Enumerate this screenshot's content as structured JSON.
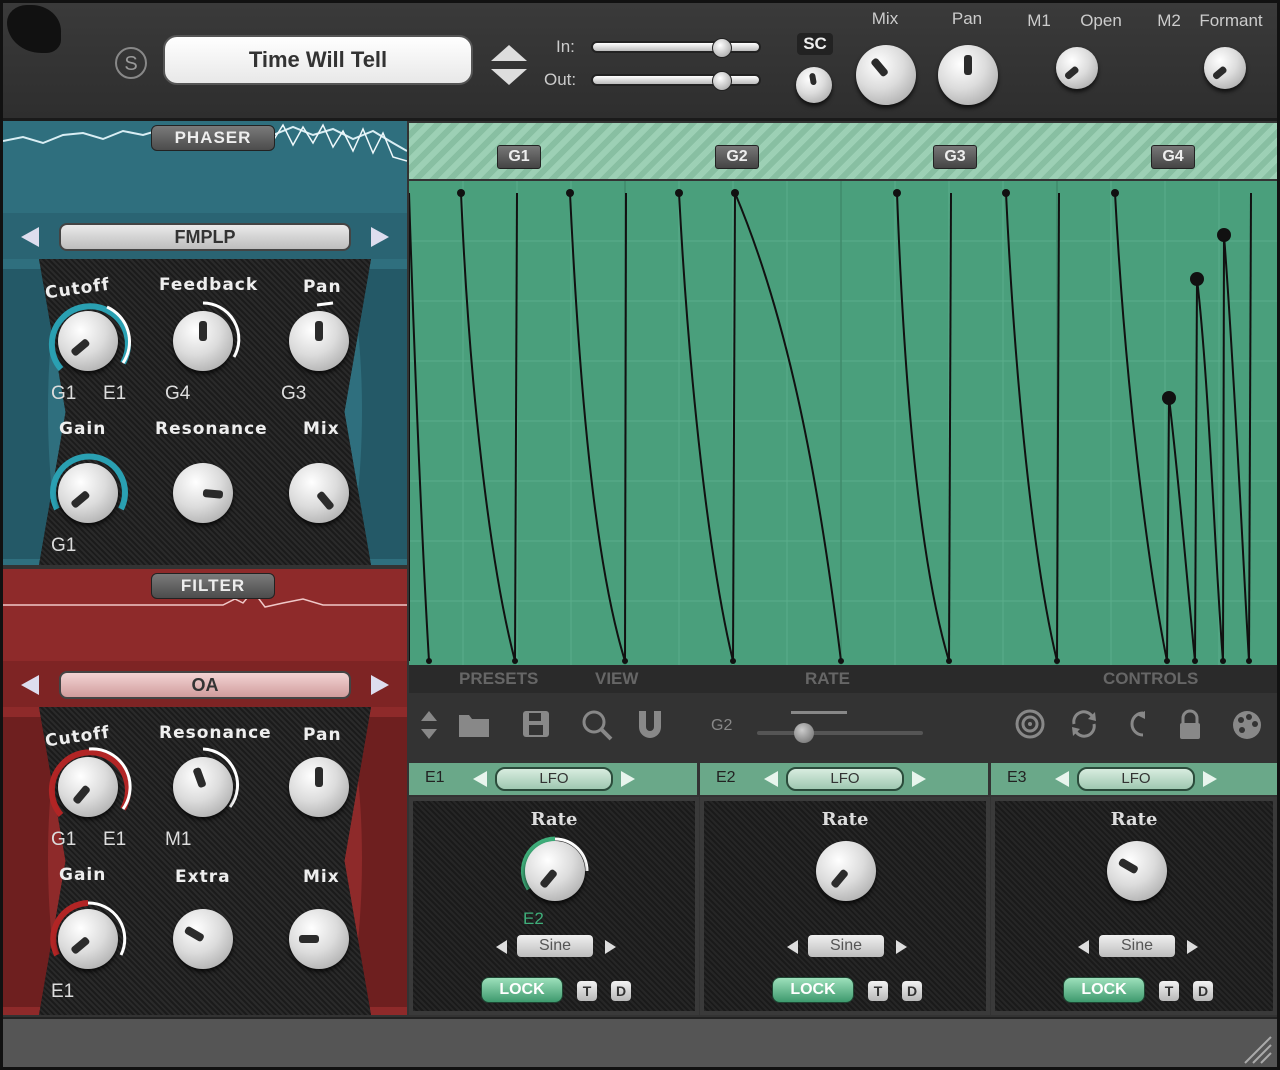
{
  "header": {
    "sc_icon": "s-logo-icon",
    "sc_icon_glyph": "S",
    "preset_name": "Time Will Tell",
    "in_label": "In:",
    "out_label": "Out:",
    "in_level": 0.78,
    "out_level": 0.78,
    "sc_label": "SC",
    "mix_label": "Mix",
    "pan_label": "Pan",
    "m1_label": "M1",
    "open_label": "Open",
    "m2_label": "M2",
    "formant_label": "Formant"
  },
  "phaser": {
    "tag": "PHASER",
    "selector": "FMPLP",
    "knobs": {
      "cutoff": "Cutoff",
      "feedback": "Feedback",
      "pan": "Pan",
      "gain": "Gain",
      "resonance": "Resonance",
      "mix": "Mix"
    },
    "mods": {
      "cutoff_a": "G1",
      "cutoff_b": "E1",
      "feedback": "G4",
      "pan": "G3",
      "gain": "G1"
    }
  },
  "filter": {
    "tag": "FILTER",
    "selector": "OA",
    "knobs": {
      "cutoff": "Cutoff",
      "resonance": "Resonance",
      "pan": "Pan",
      "gain": "Gain",
      "extra": "Extra",
      "mix": "Mix"
    },
    "mods": {
      "cutoff_a": "G1",
      "cutoff_b": "E1",
      "resonance": "M1",
      "gain": "E1"
    }
  },
  "graph": {
    "tabs": [
      "G1",
      "G2",
      "G3",
      "G4"
    ],
    "accent": "#4a9f7c"
  },
  "bottom_bar": {
    "presets": "PRESETS",
    "view": "VIEW",
    "rate": "RATE",
    "controls": "CONTROLS"
  },
  "toolbar": {
    "g2_label": "G2",
    "g2_level": 0.25,
    "icons": [
      "updown-icon",
      "folder-icon",
      "save-icon",
      "search-icon",
      "magnet-icon",
      "target-icon",
      "loop-icon",
      "undo-icon",
      "lock-icon",
      "palette-icon"
    ]
  },
  "envelopes": [
    {
      "id": "E1",
      "type": "LFO",
      "rate_label": "Rate",
      "mod": "E2",
      "shape": "Sine",
      "lock": "LOCK",
      "t": "T",
      "d": "D"
    },
    {
      "id": "E2",
      "type": "LFO",
      "rate_label": "Rate",
      "mod": "",
      "shape": "Sine",
      "lock": "LOCK",
      "t": "T",
      "d": "D"
    },
    {
      "id": "E3",
      "type": "LFO",
      "rate_label": "Rate",
      "mod": "",
      "shape": "Sine",
      "lock": "LOCK",
      "t": "T",
      "d": "D"
    }
  ],
  "colors": {
    "phaser": "#2f6f7e",
    "filter": "#8e2a2a",
    "graph_green": "#4a9f7c",
    "tab_green": "#8fc9ab"
  }
}
